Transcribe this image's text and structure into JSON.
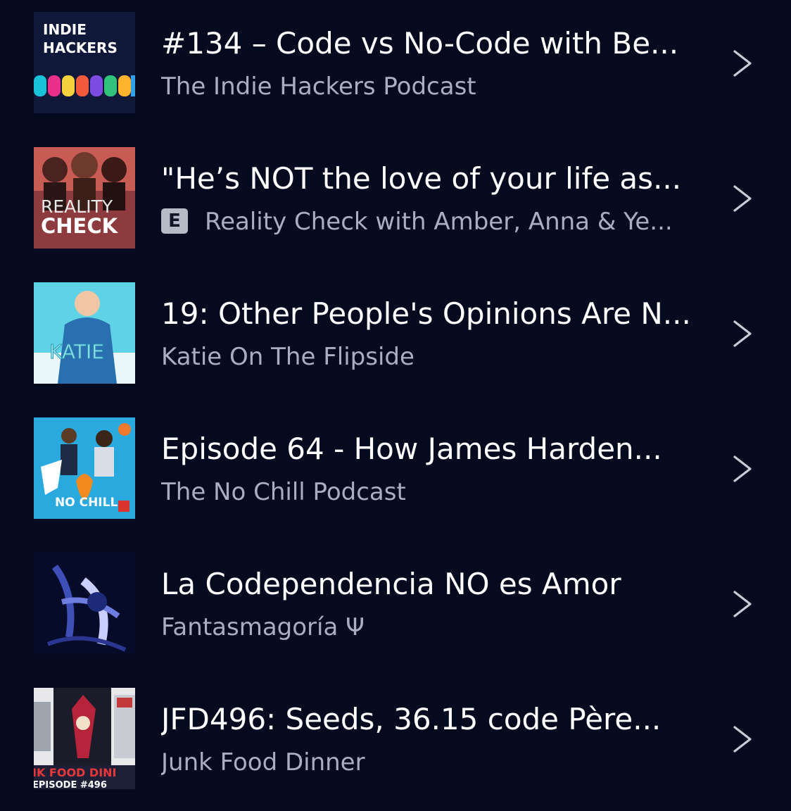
{
  "episodes": [
    {
      "title": "#134 – Code vs No-Code with Be...",
      "podcast": "The Indie Hackers Podcast",
      "explicit": false,
      "artwork_text": [
        "INDIE",
        "HACKERS"
      ]
    },
    {
      "title": "\"He’s NOT the love of your life as...",
      "podcast": "Reality Check with Amber, Anna & Ye...",
      "explicit": true,
      "explicit_label": "E",
      "artwork_text": [
        "REALITY",
        "CHECK"
      ]
    },
    {
      "title": "19: Other People's Opinions Are N...",
      "podcast": "Katie On The Flipside",
      "explicit": false,
      "artwork_text": [
        "KATIE"
      ]
    },
    {
      "title": "Episode 64 - How James Harden...",
      "podcast": "The No Chill Podcast",
      "explicit": false,
      "artwork_text": [
        "NO CHILL"
      ]
    },
    {
      "title": "La Codependencia NO es Amor",
      "podcast": "Fantasmagoría Ψ",
      "explicit": false,
      "artwork_text": []
    },
    {
      "title": "JFD496: Seeds, 36.15 code Père...",
      "podcast": "Junk Food Dinner",
      "explicit": false,
      "artwork_text": [
        "IK FOOD DINI",
        "EPISODE #496"
      ]
    }
  ],
  "icons": {
    "row_action": "chevron-right-icon",
    "explicit": "explicit-badge"
  },
  "colors": {
    "background": "#060a1f",
    "title": "#ffffff",
    "subtitle": "#a9afc0",
    "chevron": "#c9ccd6",
    "explicit_badge": "#b4bac6"
  }
}
